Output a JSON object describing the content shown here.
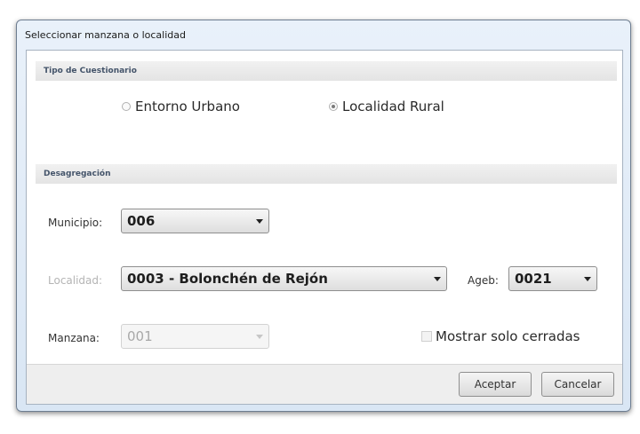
{
  "window": {
    "title": "Seleccionar manzana o localidad"
  },
  "cuestionario": {
    "header": "Tipo de Cuestionario",
    "options": [
      {
        "label": "Entorno Urbano",
        "selected": false
      },
      {
        "label": "Localidad Rural",
        "selected": true
      }
    ]
  },
  "desagregacion": {
    "header": "Desagregación",
    "municipio": {
      "label": "Municipio:",
      "value": "006"
    },
    "localidad": {
      "label": "Localidad:",
      "value": "0003 - Bolonchén de Rejón",
      "label_disabled": true
    },
    "ageb": {
      "label": "Ageb:",
      "value": "0021"
    },
    "manzana": {
      "label": "Manzana:",
      "value": "001",
      "disabled": true
    },
    "mostrar_cerradas": {
      "label": "Mostrar solo cerradas",
      "checked": false,
      "disabled": true
    }
  },
  "buttons": {
    "accept": "Aceptar",
    "cancel": "Cancelar"
  }
}
